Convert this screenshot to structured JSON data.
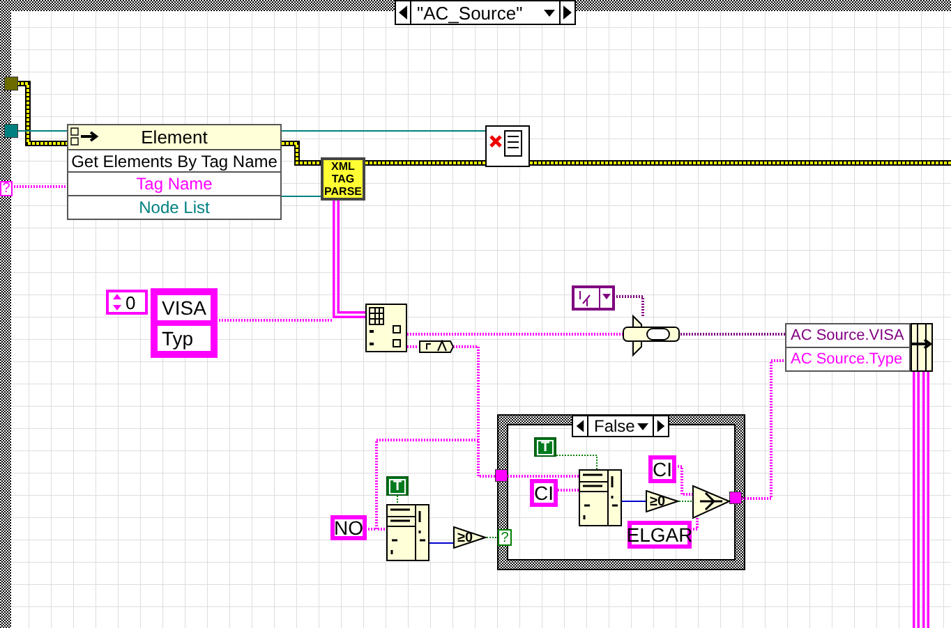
{
  "case_structure": {
    "selector": "\"AC_Source\"",
    "input_terminal": "?"
  },
  "property_node": {
    "class": "Element",
    "method": "Get Elements By Tag Name",
    "properties": [
      {
        "label": "Tag Name",
        "kind": "string"
      },
      {
        "label": "Node List",
        "kind": "reference"
      }
    ]
  },
  "subvi": {
    "lines": [
      "XML",
      "TAG",
      "PARSE"
    ]
  },
  "array_constant": {
    "index": "0",
    "elements": [
      "VISA",
      "Typ"
    ]
  },
  "outer_code": {
    "boolean": "T",
    "pattern": "NO",
    "compare": "≥0",
    "selector_terminal": "?"
  },
  "inner_case": {
    "selector": "False",
    "boolean": "T",
    "pattern": "CI",
    "compare": "≥0",
    "true_value": "CI",
    "false_value": "ELGAR"
  },
  "bundle": {
    "fields": [
      "AC Source.VISA",
      "AC Source.Type"
    ]
  }
}
